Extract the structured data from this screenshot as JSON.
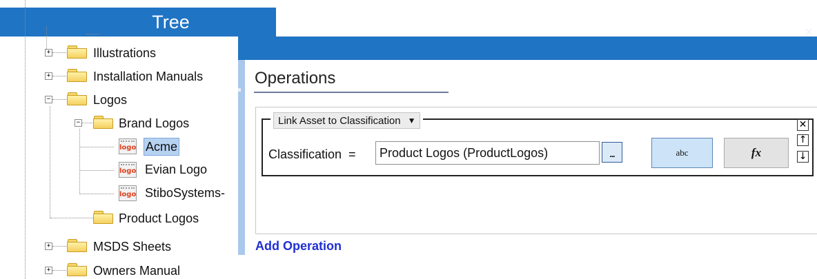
{
  "tree": {
    "title": "Tree",
    "items": [
      {
        "label": "Illustrations"
      },
      {
        "label": "Installation Manuals"
      },
      {
        "label": "Logos"
      },
      {
        "label": "Brand Logos"
      },
      {
        "label": "Acme",
        "selected": true
      },
      {
        "label": "Evian Logo"
      },
      {
        "label": "StiboSystems-"
      },
      {
        "label": "Product Logos"
      },
      {
        "label": "MSDS Sheets"
      },
      {
        "label": "Owners Manual"
      }
    ],
    "expander_plus": "+",
    "expander_minus": "−",
    "asset_icon_text": "logo"
  },
  "dialog": {
    "close_glyph": "×"
  },
  "operations": {
    "title": "Operations",
    "operation_type": "Link Asset to Classification",
    "operation_type_caret": "▼",
    "field_label": "Classification  =",
    "field_value": "Product Logos (ProductLogos)",
    "browse_label": "...",
    "abc_label": "abc",
    "fx_label": "fx",
    "remove_glyph": "✕",
    "move_up_glyph": "↑",
    "move_down_glyph": "↓",
    "add_operation": "Add Operation"
  },
  "colors": {
    "header_blue": "#1f74c4",
    "splitter_blue": "#a9c8ec",
    "link_blue": "#1f2fd4",
    "selection": "#b7d2f1"
  }
}
